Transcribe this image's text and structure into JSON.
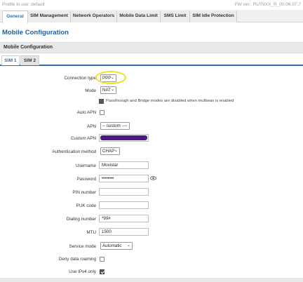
{
  "topbar": {
    "profile": "Profile in use: default",
    "firmware": "FW ver.: RUT9XX_R_00.06.07.7"
  },
  "tabs": [
    {
      "label": "General",
      "active": true
    },
    {
      "label": "SIM Management",
      "active": false
    },
    {
      "label": "Network Operators",
      "active": false
    },
    {
      "label": "Mobile Data Limit",
      "active": false
    },
    {
      "label": "SMS Limit",
      "active": false
    },
    {
      "label": "SIM Idle Protection",
      "active": false
    }
  ],
  "page_title": "Mobile Configuration",
  "section_title": "Mobile Configuration",
  "sim_tabs": [
    {
      "label": "SIM 1",
      "active": true
    },
    {
      "label": "SIM 2",
      "active": false
    }
  ],
  "form": {
    "connection_type": {
      "label": "Connection type",
      "value": "PPP"
    },
    "mode": {
      "label": "Mode",
      "value": "NAT"
    },
    "mode_note": "Passthrough and Bridge modes are disabled when multiwan is enabled",
    "auto_apn": {
      "label": "Auto APN",
      "checked": false
    },
    "apn": {
      "label": "APN",
      "value": "-- custom --"
    },
    "custom_apn": {
      "label": "Custom APN",
      "value": ""
    },
    "auth_method": {
      "label": "Authentication method",
      "value": "CHAP"
    },
    "username": {
      "label": "Username",
      "value": "Movistar"
    },
    "password": {
      "label": "Password",
      "value": "••••••••"
    },
    "pin": {
      "label": "PIN number",
      "value": ""
    },
    "puk": {
      "label": "PUK code",
      "value": ""
    },
    "dialing": {
      "label": "Dialing number",
      "value": "*99#"
    },
    "mtu": {
      "label": "MTU",
      "value": "1500"
    },
    "service_mode": {
      "label": "Service mode",
      "value": "Automatic"
    },
    "deny_roaming": {
      "label": "Deny data roaming",
      "checked": false
    },
    "ipv4_only": {
      "label": "Use IPv4 only",
      "checked": true
    }
  },
  "colors": {
    "accent": "#2c6fb0",
    "highlight": "#f0e028",
    "redaction": "#4a1a8a"
  },
  "icons": {
    "info": "info-icon",
    "password_toggle": "eye-icon",
    "dropdown": "chevron-down-icon"
  }
}
